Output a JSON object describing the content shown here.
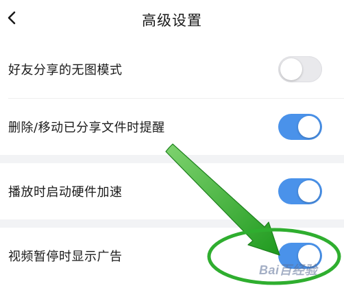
{
  "header": {
    "title": "高级设置",
    "back_icon": "chevron-left-icon"
  },
  "settings": [
    {
      "label": "好友分享的无图模式",
      "enabled": false
    },
    {
      "label": "删除/移动已分享文件时提醒",
      "enabled": true
    },
    {
      "label": "播放时启动硬件加速",
      "enabled": true
    },
    {
      "label": "视频暂停时显示广告",
      "enabled": true
    }
  ],
  "colors": {
    "toggle_on": "#4a92ea",
    "toggle_off": "#e9e9ec",
    "annotation_green": "#2fae2f",
    "section_gap": "#f2f3f5"
  },
  "watermark": {
    "text": "Bai百经验"
  }
}
